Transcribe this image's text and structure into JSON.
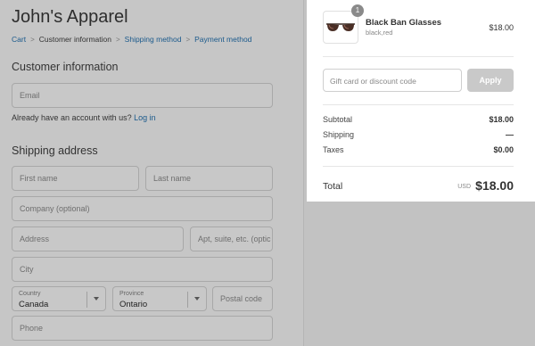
{
  "shop": {
    "title": "John's Apparel"
  },
  "breadcrumb": {
    "cart": "Cart",
    "customer_info": "Customer information",
    "shipping_method": "Shipping method",
    "payment_method": "Payment method",
    "separator": ">"
  },
  "customer": {
    "title": "Customer information",
    "email_placeholder": "Email",
    "account_prompt": "Already have an account with us?",
    "login_link": "Log in"
  },
  "shipping": {
    "title": "Shipping address",
    "first_name_placeholder": "First name",
    "last_name_placeholder": "Last name",
    "company_placeholder": "Company (optional)",
    "address_placeholder": "Address",
    "apt_placeholder": "Apt, suite, etc. (optic",
    "city_placeholder": "City",
    "country_label": "Country",
    "country_value": "Canada",
    "province_label": "Province",
    "province_value": "Ontario",
    "postal_placeholder": "Postal code",
    "phone_placeholder": "Phone"
  },
  "summary": {
    "product": {
      "quantity": "1",
      "name": "Black Ban Glasses",
      "variant": "black,red",
      "price": "$18.00",
      "icon": "sunglasses-icon"
    },
    "discount_placeholder": "Gift card or discount code",
    "apply_label": "Apply",
    "subtotal_label": "Subtotal",
    "subtotal_value": "$18.00",
    "shipping_label": "Shipping",
    "shipping_value": "—",
    "taxes_label": "Taxes",
    "taxes_value": "$0.00",
    "total_label": "Total",
    "total_currency": "USD",
    "total_value": "$18.00"
  },
  "colors": {
    "link": "#1b5a8c",
    "overlay": "#c6c6c6",
    "summary_bg": "#ffffff"
  }
}
